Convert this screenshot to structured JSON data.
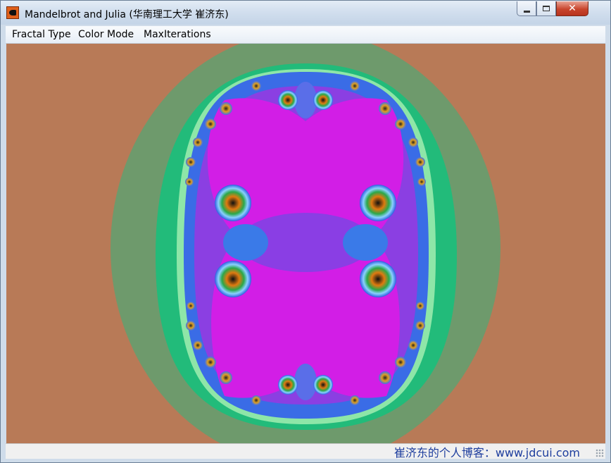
{
  "window": {
    "title": "Mandelbrot and Julia (华南理工大学 崔济东)",
    "app_icon": "fractal-app-icon",
    "controls": {
      "minimize": "minimize-icon",
      "maximize": "maximize-icon",
      "close": "close-icon"
    },
    "close_glyph": "✕"
  },
  "menu": {
    "items": [
      {
        "label": "Fractal Type"
      },
      {
        "label": "Color Mode"
      },
      {
        "label": "MaxIterations"
      }
    ]
  },
  "fractal": {
    "kind": "Julia set",
    "colors": {
      "background": "#b87a57",
      "outer_ring": "#6e9a6c",
      "green_ring": "#22bb7a",
      "mint": "#8ee6a8",
      "blue": "#2f5fe0",
      "violet": "#8a3ee0",
      "magenta": "#d61ee6",
      "pink": "#e020e0"
    }
  },
  "statusbar": {
    "text": "崔济东的个人博客：www.jdcui.com"
  }
}
